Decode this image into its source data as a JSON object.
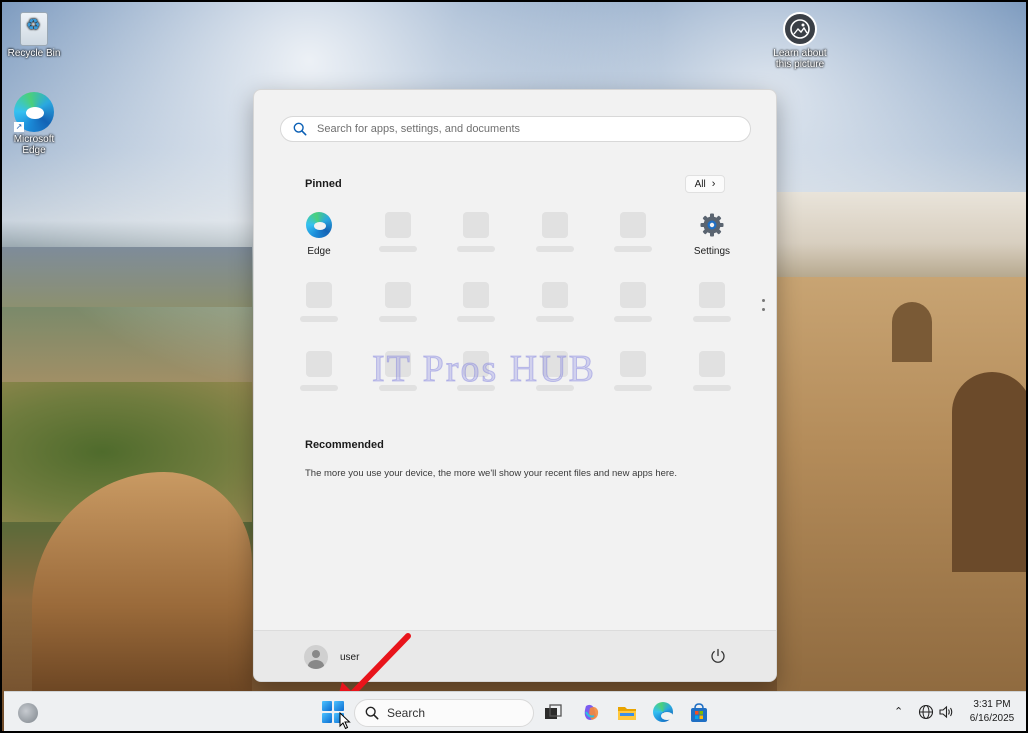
{
  "desktop": {
    "icons": [
      {
        "label": "Recycle Bin"
      },
      {
        "label": "Microsoft Edge"
      },
      {
        "label": "Learn about this picture"
      }
    ]
  },
  "start_menu": {
    "search_placeholder": "Search for apps, settings, and documents",
    "pinned_title": "Pinned",
    "all_label": "All",
    "pinned_apps": [
      {
        "label": "Edge",
        "icon": "edge-icon"
      },
      {
        "label": "Settings",
        "icon": "gear-icon"
      }
    ],
    "recommended_title": "Recommended",
    "recommended_text": "The more you use your device, the more we'll show your recent files and new apps here.",
    "user_name": "user"
  },
  "watermark": "IT Pros HUB",
  "taskbar": {
    "search_label": "Search",
    "time": "3:31 PM",
    "date": "6/16/2025",
    "pinned": [
      "copilot-icon",
      "file-explorer-icon",
      "edge-icon",
      "store-icon"
    ]
  },
  "colors": {
    "accent": "#0a6cd1",
    "arrow": "#e8141b",
    "menu_bg": "#f2f2f2"
  }
}
